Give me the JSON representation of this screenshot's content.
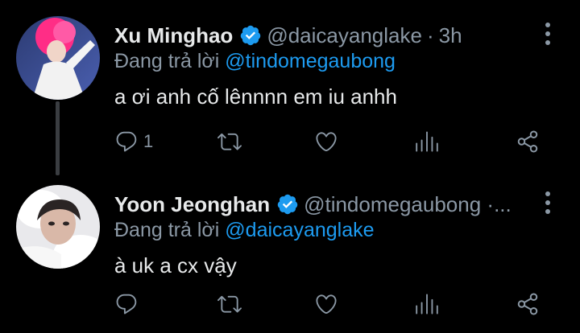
{
  "colors": {
    "background": "#000000",
    "text": "#e7e9ea",
    "muted": "#8b98a5",
    "accent": "#1d9bf0",
    "thread_line": "#3a3d41"
  },
  "tweets": [
    {
      "name": "Xu Minghao",
      "handle": "@daicayanglake",
      "dot": "·",
      "time": "3h",
      "replying_prefix": "Đang trả lời",
      "replying_to": "@tindomegaubong",
      "text": "a ơi anh cố lênnnn em iu anhh",
      "reply_count": "1",
      "icons": [
        "reply-icon",
        "retweet-icon",
        "like-icon",
        "analytics-icon",
        "share-icon",
        "more-icon"
      ]
    },
    {
      "name": "Yoon Jeonghan",
      "handle": "@tindomegaubong ·...",
      "dot": "",
      "time": "",
      "replying_prefix": "Đang trả lời",
      "replying_to": "@daicayanglake",
      "text": "à uk a cx vậy",
      "reply_count": "",
      "icons": [
        "reply-icon",
        "retweet-icon",
        "like-icon",
        "analytics-icon",
        "share-icon",
        "more-icon"
      ]
    }
  ]
}
